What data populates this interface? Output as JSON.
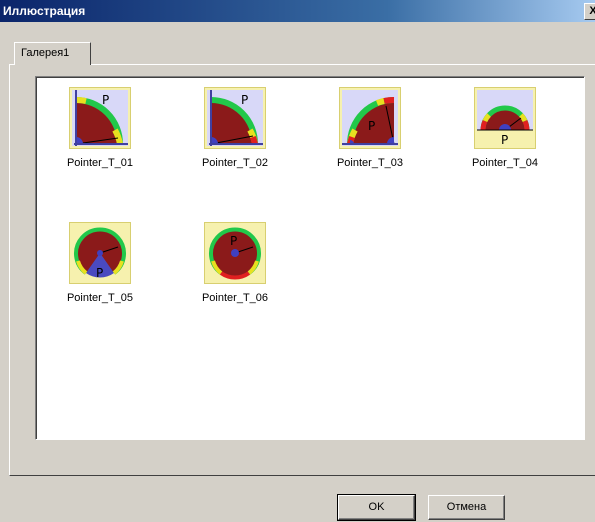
{
  "window": {
    "title": "Иллюстрация",
    "close_glyph": "X"
  },
  "tabs": [
    {
      "label": "Галерея1",
      "selected": true
    }
  ],
  "gallery": {
    "items": [
      {
        "label": "Pointer_T_01",
        "letter": "P",
        "icon": "quarter-gauge-left-icon"
      },
      {
        "label": "Pointer_T_02",
        "letter": "P",
        "icon": "quarter-gauge-left-icon"
      },
      {
        "label": "Pointer_T_03",
        "letter": "P",
        "icon": "quarter-gauge-right-icon"
      },
      {
        "label": "Pointer_T_04",
        "letter": "P",
        "icon": "half-gauge-icon"
      },
      {
        "label": "Pointer_T_05",
        "letter": "P",
        "icon": "round-gauge-wedge-icon"
      },
      {
        "label": "Pointer_T_06",
        "letter": "P",
        "icon": "round-gauge-icon"
      }
    ]
  },
  "buttons": {
    "ok": "OK",
    "cancel": "Отмена"
  },
  "colors": {
    "title_bar": "#0a246a",
    "gauge_face": "#8b1a1a",
    "scale_green": "#22c84a",
    "scale_yellow": "#e8e020",
    "scale_red": "#e02020",
    "panel_blue": "#d8d8f8",
    "thumb_background": "#f6f1ae"
  }
}
